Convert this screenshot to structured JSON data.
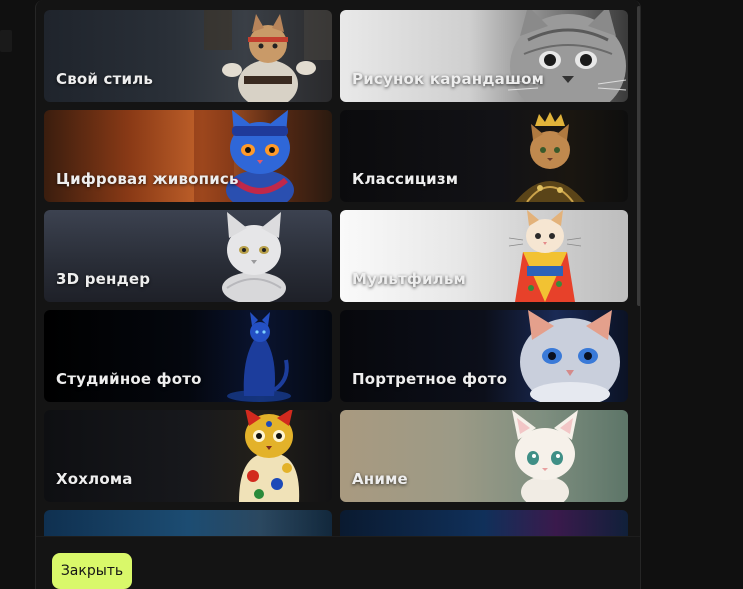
{
  "styles": [
    {
      "label": "Свой стиль",
      "bg": "bg-own",
      "art": "kungfu-cat"
    },
    {
      "label": "Рисунок карандашом",
      "bg": "bg-pencil",
      "art": "pencil-cat"
    },
    {
      "label": "Цифровая живопись",
      "bg": "bg-digital",
      "art": "ninja-cat"
    },
    {
      "label": "Классицизм",
      "bg": "bg-classic",
      "art": "king-cat"
    },
    {
      "label": "3D рендер",
      "bg": "bg-3d",
      "art": "sculpture-cat"
    },
    {
      "label": "Мультфильм",
      "bg": "bg-cartoon",
      "art": "kimono-cat"
    },
    {
      "label": "Студийное фото",
      "bg": "bg-studio",
      "art": "blue-cat"
    },
    {
      "label": "Портретное фото",
      "bg": "bg-portrait",
      "art": "portrait-cat"
    },
    {
      "label": "Хохлома",
      "bg": "bg-khokh",
      "art": "khokhloma-cat"
    },
    {
      "label": "Аниме",
      "bg": "bg-anime",
      "art": "anime-cat"
    },
    {
      "label": "",
      "bg": "bg-r6a",
      "art": "tabby-cat"
    },
    {
      "label": "",
      "bg": "bg-r6b",
      "art": "neon-cat"
    }
  ],
  "footer": {
    "close_label": "Закрыть"
  },
  "colors": {
    "accent": "#d9f86a",
    "dialog_bg": "#141414",
    "label_text": "#eeeeee"
  }
}
